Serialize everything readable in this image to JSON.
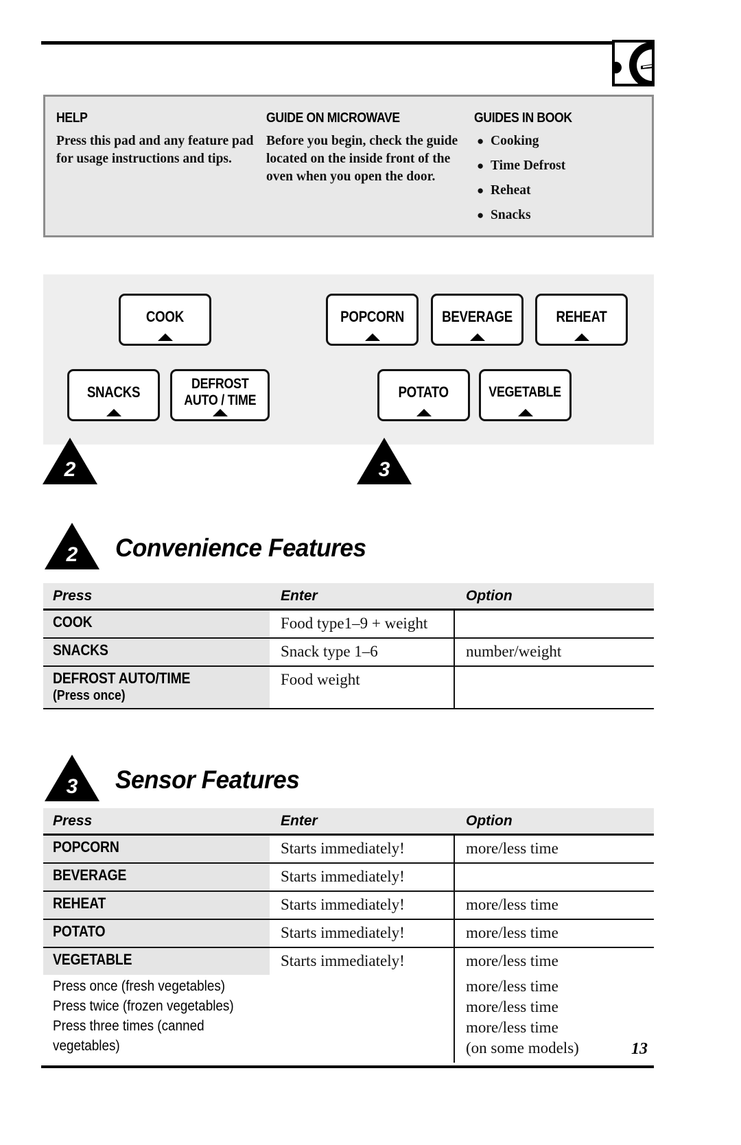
{
  "logo": {
    "name": "ge-monogram-logo",
    "description": "partial GE monogram in box at page edge"
  },
  "info_box": {
    "columns": [
      {
        "heading": "HELP",
        "body": "Press this pad and any feature pad for usage instructions and tips.",
        "items": []
      },
      {
        "heading": "GUIDE ON MICROWAVE",
        "body": "Before you begin, check the guide located on the inside front of the oven when you open the door.",
        "items": []
      },
      {
        "heading": "GUIDES IN BOOK",
        "body": "",
        "items": [
          "Cooking",
          "Time Defrost",
          "Reheat",
          "Snacks"
        ]
      }
    ]
  },
  "keypad": {
    "buttons": [
      {
        "label": "COOK",
        "group": "convenience"
      },
      {
        "label": "POPCORN",
        "group": "sensor"
      },
      {
        "label": "BEVERAGE",
        "group": "sensor"
      },
      {
        "label": "REHEAT",
        "group": "sensor"
      },
      {
        "label": "SNACKS",
        "group": "convenience"
      },
      {
        "label": "DEFROST\nAUTO / TIME",
        "group": "convenience"
      },
      {
        "label": "POTATO",
        "group": "sensor"
      },
      {
        "label": "VEGETABLE",
        "group": "sensor"
      }
    ],
    "callouts": [
      {
        "number": "2"
      },
      {
        "number": "3"
      }
    ]
  },
  "sections": [
    {
      "badge": "2",
      "title": "Convenience Features",
      "table": {
        "headers": [
          "Press",
          "Enter",
          "Option"
        ],
        "rows": [
          {
            "press": "COOK",
            "press_sub": "",
            "enter": "Food type1–9 + weight",
            "option": ""
          },
          {
            "press": "SNACKS",
            "press_sub": "",
            "enter": "Snack type 1–6",
            "option": "number/weight"
          },
          {
            "press": "DEFROST AUTO/TIME",
            "press_sub": "(Press once)",
            "enter": "Food weight",
            "option": ""
          }
        ]
      }
    },
    {
      "badge": "3",
      "title": "Sensor Features",
      "table": {
        "headers": [
          "Press",
          "Enter",
          "Option"
        ],
        "rows": [
          {
            "press": "POPCORN",
            "press_sub": "",
            "enter": "Starts immediately!",
            "option": "more/less time"
          },
          {
            "press": "BEVERAGE",
            "press_sub": "",
            "enter": "Starts immediately!",
            "option": ""
          },
          {
            "press": "REHEAT",
            "press_sub": "",
            "enter": "Starts immediately!",
            "option": "more/less time"
          },
          {
            "press": "POTATO",
            "press_sub": "",
            "enter": "Starts immediately!",
            "option": "more/less time"
          },
          {
            "press": "VEGETABLE",
            "press_sub": "",
            "enter": "Starts immediately!",
            "option": "more/less time"
          }
        ],
        "vegetable_extra": {
          "notes": [
            "Press once (fresh vegetables)",
            "Press twice (frozen vegetables)",
            "Press three times (canned vegetables)"
          ],
          "options": [
            "more/less time",
            "more/less time",
            "more/less time",
            "(on some models)"
          ]
        }
      }
    }
  ],
  "footer": {
    "page_number": "13"
  }
}
